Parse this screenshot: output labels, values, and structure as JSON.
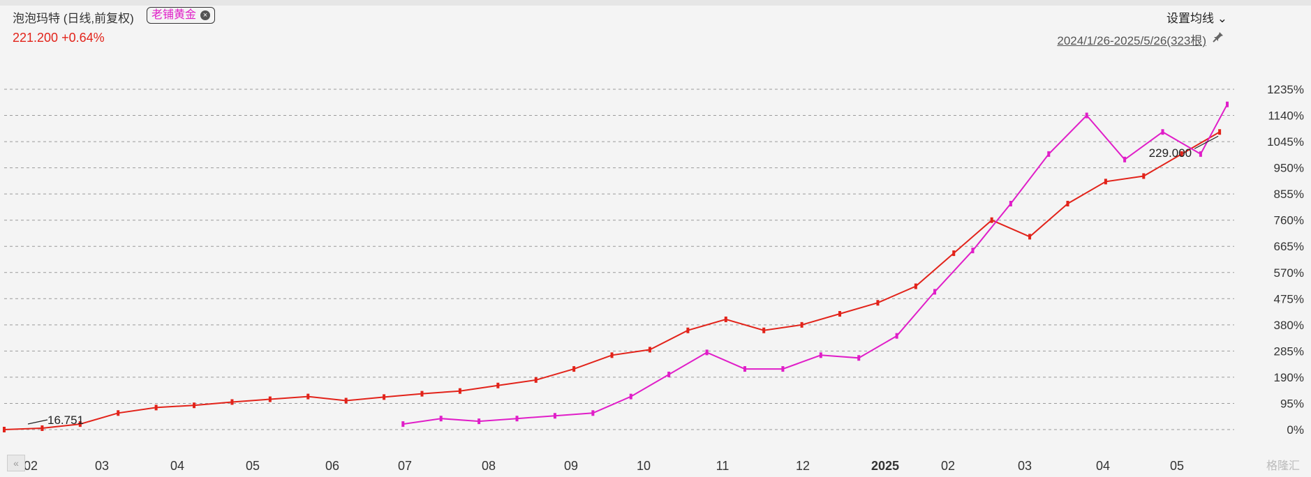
{
  "header": {
    "title": "泡泡玛特 (日线,前复权)",
    "compare_tag": "老铺黄金",
    "price": "221.200",
    "change": "+0.64%",
    "ma_setting": "设置均线",
    "range": "2024/1/26-2025/5/26(323根)"
  },
  "watermark": "格隆汇",
  "chart_data": {
    "type": "line",
    "y_unit": "%",
    "y_ticks": [
      "0%",
      "95%",
      "190%",
      "285%",
      "380%",
      "475%",
      "570%",
      "665%",
      "760%",
      "855%",
      "950%",
      "1045%",
      "1140%",
      "1235%"
    ],
    "x_ticks": [
      "02",
      "03",
      "04",
      "05",
      "06",
      "07",
      "08",
      "09",
      "10",
      "11",
      "12",
      "2025",
      "02",
      "03",
      "04",
      "05"
    ],
    "ylim": [
      0,
      1235
    ],
    "annotations": [
      {
        "text": "16.751",
        "series": "泡泡玛特",
        "position": "start-low"
      },
      {
        "text": "229.000",
        "series": "泡泡玛特",
        "position": "end-high"
      }
    ],
    "series": [
      {
        "name": "泡泡玛特",
        "color": "#e2231a",
        "x_index": [
          0,
          10,
          20,
          30,
          40,
          50,
          60,
          70,
          80,
          90,
          100,
          110,
          120,
          130,
          140,
          150,
          160,
          170,
          180,
          190,
          200,
          210,
          220,
          230,
          240,
          250,
          260,
          270,
          280,
          290,
          300,
          310,
          320
        ],
        "values": [
          0,
          5,
          20,
          60,
          80,
          88,
          100,
          110,
          120,
          105,
          118,
          130,
          140,
          160,
          180,
          220,
          270,
          290,
          360,
          400,
          360,
          380,
          420,
          460,
          520,
          640,
          760,
          700,
          820,
          900,
          920,
          1000,
          1080
        ]
      },
      {
        "name": "老铺黄金",
        "color": "#e01ec8",
        "x_index": [
          105,
          115,
          125,
          135,
          145,
          155,
          165,
          175,
          185,
          195,
          205,
          215,
          225,
          235,
          245,
          255,
          265,
          275,
          285,
          295,
          305,
          315,
          322
        ],
        "values": [
          20,
          40,
          30,
          40,
          50,
          60,
          120,
          200,
          280,
          220,
          220,
          270,
          260,
          340,
          500,
          650,
          820,
          1000,
          1140,
          980,
          1080,
          1000,
          1180
        ]
      }
    ]
  }
}
